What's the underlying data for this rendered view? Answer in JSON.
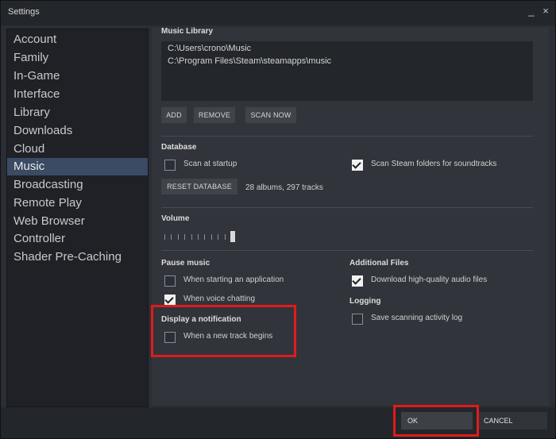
{
  "window": {
    "title": "Settings",
    "minimize_glyph": "_",
    "close_glyph": "×"
  },
  "sidebar": {
    "items": [
      {
        "label": "Account",
        "active": false
      },
      {
        "label": "Family",
        "active": false
      },
      {
        "label": "In-Game",
        "active": false
      },
      {
        "label": "Interface",
        "active": false
      },
      {
        "label": "Library",
        "active": false
      },
      {
        "label": "Downloads",
        "active": false
      },
      {
        "label": "Cloud",
        "active": false
      },
      {
        "label": "Music",
        "active": true
      },
      {
        "label": "Broadcasting",
        "active": false
      },
      {
        "label": "Remote Play",
        "active": false
      },
      {
        "label": "Web Browser",
        "active": false
      },
      {
        "label": "Controller",
        "active": false
      },
      {
        "label": "Shader Pre-Caching",
        "active": false
      }
    ]
  },
  "music_library": {
    "title": "Music Library",
    "paths": [
      "C:\\Users\\crono\\Music",
      "C:\\Program Files\\Steam\\steamapps\\music"
    ],
    "add_label": "ADD",
    "remove_label": "REMOVE",
    "scan_label": "SCAN NOW"
  },
  "database": {
    "title": "Database",
    "scan_startup": {
      "label": "Scan at startup",
      "checked": false
    },
    "scan_steam": {
      "label": "Scan Steam folders for soundtracks",
      "checked": true
    },
    "reset_label": "RESET DATABASE",
    "stats": "28 albums, 297 tracks"
  },
  "volume": {
    "title": "Volume",
    "level": 1.0
  },
  "pause_music": {
    "title": "Pause music",
    "starting_app": {
      "label": "When starting an application",
      "checked": false
    },
    "voice_chat": {
      "label": "When voice chatting",
      "checked": true
    }
  },
  "notification": {
    "title": "Display a notification",
    "new_track": {
      "label": "When a new track begins",
      "checked": false
    }
  },
  "additional_files": {
    "title": "Additional Files",
    "hq_audio": {
      "label": "Download high-quality audio files",
      "checked": true
    }
  },
  "logging": {
    "title": "Logging",
    "save_log": {
      "label": "Save scanning activity log",
      "checked": false
    }
  },
  "footer": {
    "ok_label": "OK",
    "cancel_label": "CANCEL"
  },
  "colors": {
    "highlight": "#e01b1b",
    "active_nav": "#3a4b63",
    "background": "#2b2e34"
  }
}
